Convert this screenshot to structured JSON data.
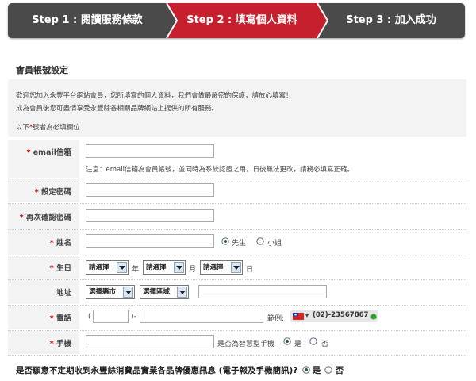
{
  "steps": [
    {
      "label": "Step 1 : 閱讀服務條款",
      "active": false
    },
    {
      "label": "Step 2 : 填寫個人資料",
      "active": true
    },
    {
      "label": "Step 3 : 加入成功",
      "active": false
    }
  ],
  "colors": {
    "active_step": "#c6202e",
    "inactive_step": "#4a4a4a",
    "required_star": "#cc0000",
    "label_bg": "#f3f3f3"
  },
  "section_title": "會員帳號設定",
  "intro": {
    "line1": "歡迎您加入永豐平台網站會員，您所填寫的個人資料，我們會做最嚴密的保護，請放心填寫！",
    "line2": "成為會員後您可盡情享受永豐餘各相關品牌網站上提供的所有服務。",
    "required_note_prefix": "以下",
    "star": "*",
    "required_note_suffix": "號者為必填欄位"
  },
  "form": {
    "email": {
      "label": "email信箱",
      "value": "",
      "note": "注意：email信箱為會員帳號，並同時為系統認證之用，日後無法更改，請務必填寫正確。"
    },
    "password": {
      "label": "設定密碼",
      "value": ""
    },
    "confirm_password": {
      "label": "再次確認密碼",
      "value": ""
    },
    "name": {
      "label": "姓名",
      "value": "",
      "gender_options": [
        "先生",
        "小姐"
      ],
      "selected": "先生"
    },
    "birthday": {
      "label": "生日",
      "year": "請選擇",
      "year_unit": "年",
      "month": "請選擇",
      "month_unit": "月",
      "day": "請選擇",
      "day_unit": "日"
    },
    "address": {
      "label": "地址",
      "city": "選擇縣市",
      "district": "選擇區域",
      "value": ""
    },
    "phone": {
      "label": "電話",
      "area_code": "",
      "number": "",
      "open_paren": "(",
      "close_paren": ")-",
      "example_label": "範例:",
      "example_value": "(02)-23567867"
    },
    "mobile": {
      "label": "手機",
      "value": "",
      "smartphone_question": "是否為智慧型手機",
      "options": [
        "是",
        "否"
      ],
      "selected": "是"
    }
  },
  "subscribe": {
    "question": "是否願意不定期收到永豐餘消費品實業各品牌優惠訊息 (電子報及手機簡訊)?",
    "options": [
      "是",
      "否"
    ],
    "selected": "是"
  }
}
